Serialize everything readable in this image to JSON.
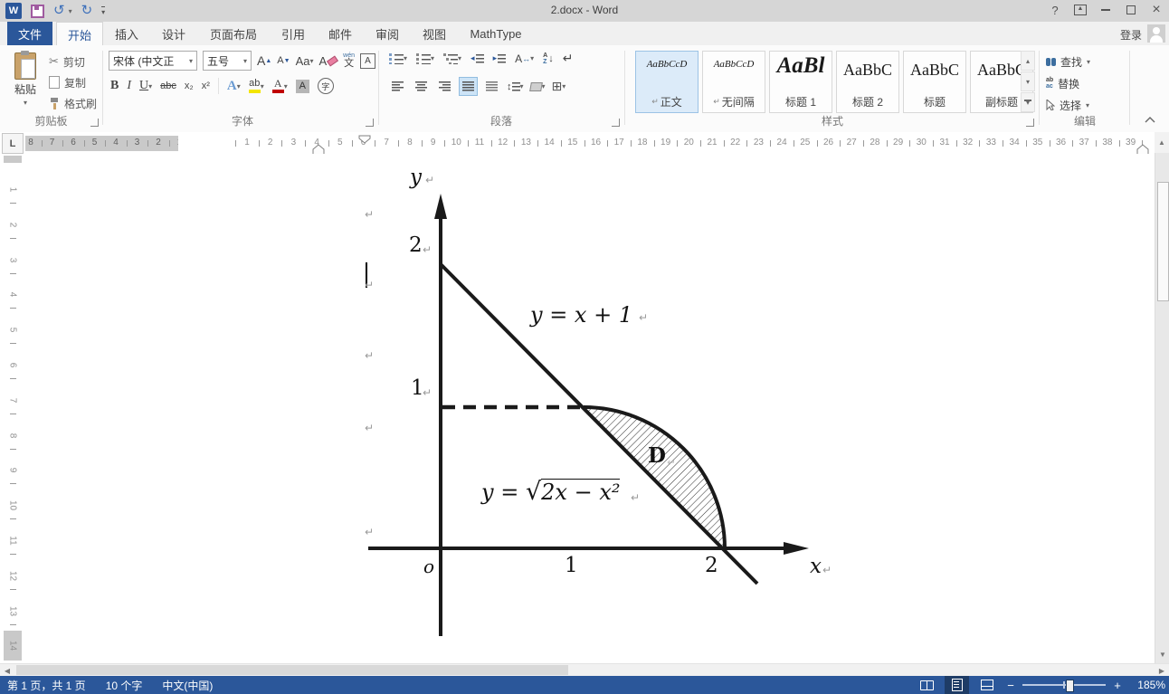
{
  "window": {
    "title": "2.docx - Word",
    "help_glyph": "?",
    "signin_label": "登录"
  },
  "tabs": [
    {
      "label": "文件"
    },
    {
      "label": "开始"
    },
    {
      "label": "插入"
    },
    {
      "label": "设计"
    },
    {
      "label": "页面布局"
    },
    {
      "label": "引用"
    },
    {
      "label": "邮件"
    },
    {
      "label": "审阅"
    },
    {
      "label": "视图"
    },
    {
      "label": "MathType"
    }
  ],
  "ribbon": {
    "clipboard": {
      "group_label": "剪贴板",
      "paste_label": "粘贴",
      "cut_label": "剪切",
      "copy_label": "复制",
      "format_painter_label": "格式刷"
    },
    "font": {
      "group_label": "字体",
      "font_name_value": "宋体 (中文正",
      "font_size_value": "五号",
      "grow": "A",
      "shrink": "A",
      "change_case": "Aa",
      "clear_format": "A",
      "phonetic_top": "wén",
      "phonetic": "文",
      "char_border": "A",
      "bold": "B",
      "italic": "I",
      "underline": "U",
      "strikethrough": "abc",
      "subscript": "x₂",
      "superscript": "x²",
      "text_effects": "A",
      "highlight": "ab",
      "font_color": "A",
      "char_shading": "A",
      "enclose": "字"
    },
    "paragraph": {
      "group_label": "段落",
      "asian_layout": "A",
      "asian_arrows": "↔",
      "sort_top": "A",
      "sort_bottom": "Z",
      "sort_arrow": "↓",
      "show_marks": "↵",
      "spacing_glyph": "↕",
      "borders_glyph": "⊞"
    },
    "styles": {
      "group_label": "样式",
      "pilcrow": "↵",
      "items": [
        {
          "preview": "AaBbCcD",
          "label": "正文"
        },
        {
          "preview": "AaBbCcD",
          "label": "无间隔"
        },
        {
          "preview": "AaBl",
          "label": "标题 1"
        },
        {
          "preview": "AaBbC",
          "label": "标题 2"
        },
        {
          "preview": "AaBbC",
          "label": "标题"
        },
        {
          "preview": "AaBbC",
          "label": "副标题"
        }
      ]
    },
    "editing": {
      "group_label": "编辑",
      "find_label": "查找",
      "replace_label": "替换",
      "select_label": "选择",
      "replace_icon_top": "ab",
      "replace_icon_bottom": "ac"
    }
  },
  "ruler": {
    "tab_selector": "L",
    "margin_numbers": [
      "8",
      "7",
      "6",
      "5",
      "4",
      "3",
      "2",
      "1"
    ],
    "main_numbers": [
      "1",
      "2",
      "3",
      "4",
      "5",
      "6",
      "7",
      "8",
      "9",
      "10",
      "11",
      "12",
      "13",
      "14",
      "15",
      "16",
      "17",
      "18",
      "19",
      "20",
      "21",
      "22",
      "23",
      "24",
      "25",
      "26",
      "27",
      "28",
      "29",
      "30",
      "31",
      "32",
      "33",
      "34",
      "35",
      "36",
      "37",
      "38",
      "39"
    ],
    "vertical_numbers": [
      "1",
      "2",
      "3",
      "4",
      "5",
      "6",
      "7",
      "8",
      "9",
      "10",
      "11",
      "12",
      "13",
      "14"
    ]
  },
  "document": {
    "pilcrow": "↵",
    "figure": {
      "y_axis_label": "y",
      "x_axis_label": "x",
      "origin": "o",
      "y_tick_top": "2",
      "y_tick_mid": "1",
      "x_tick_mid": "1",
      "x_tick_right": "2",
      "line_equation": "y = x + 1",
      "sqrt_lhs": "y = ",
      "sqrt_sign": "√",
      "sqrt_radicand": "2x − x²",
      "region_label": "D"
    }
  },
  "status": {
    "page_info": "第 1 页，共 1 页",
    "word_count": "10 个字",
    "language": "中文(中国)",
    "zoom_minus": "−",
    "zoom_plus": "+",
    "zoom_level": "185%"
  }
}
